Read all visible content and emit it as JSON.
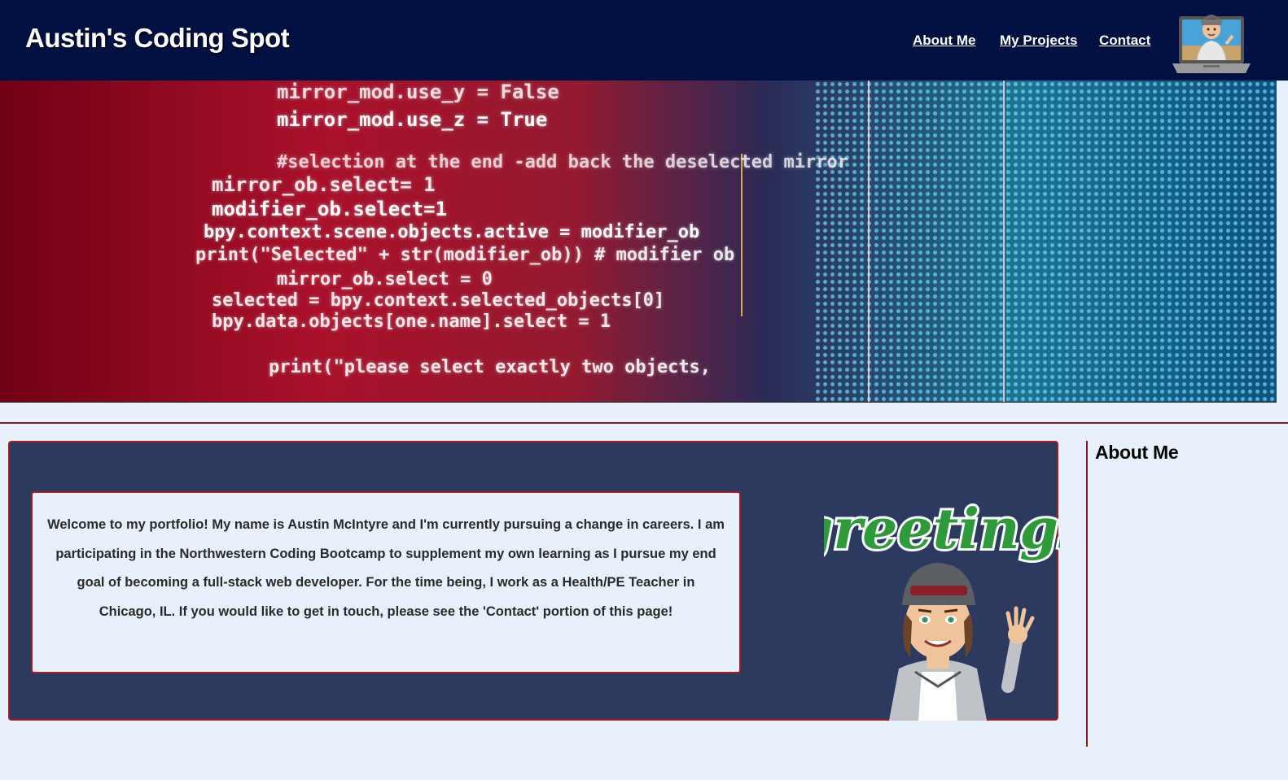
{
  "header": {
    "title": "Austin's Coding Spot",
    "nav": [
      {
        "label": "About Me"
      },
      {
        "label": "My Projects"
      },
      {
        "label": "Contact"
      }
    ],
    "avatar_icon": "laptop-avatar-icon"
  },
  "banner": {
    "code_lines": [
      "mirror_mod.use_y = False",
      "mirror_mod.use_z = True",
      "#selection at the end -add back the deselected mirror",
      "mirror_ob.select= 1",
      "modifier_ob.select=1",
      "bpy.context.scene.objects.active = modifier_ob",
      "print(\"Selected\" + str(modifier_ob)) # modifier ob",
      "mirror_ob.select = 0",
      "selected = bpy.context.selected_objects[0]",
      "bpy.data.objects[one.name].select = 1",
      "print(\"please select exactly two objects,"
    ]
  },
  "main": {
    "intro_text": "Welcome to my portfolio! My name is Austin McIntyre and I'm currently pursuing a change in careers. I am participating in the Northwestern Coding Bootcamp to supplement my own learning as I pursue my end goal of becoming a full-stack web developer. For the time being, I work as a Health/PE Teacher in Chicago, IL. If you would like to get in touch, please see the 'Contact' portion of this page!",
    "greeting_art_text": "greetings"
  },
  "sidebar": {
    "title": "About Me"
  },
  "colors": {
    "header_bg": "#001042",
    "page_bg": "#e8f1fb",
    "card_bg": "#2d3a60",
    "accent_red": "#a11d21",
    "greeting_green": "#2e9b3b"
  }
}
